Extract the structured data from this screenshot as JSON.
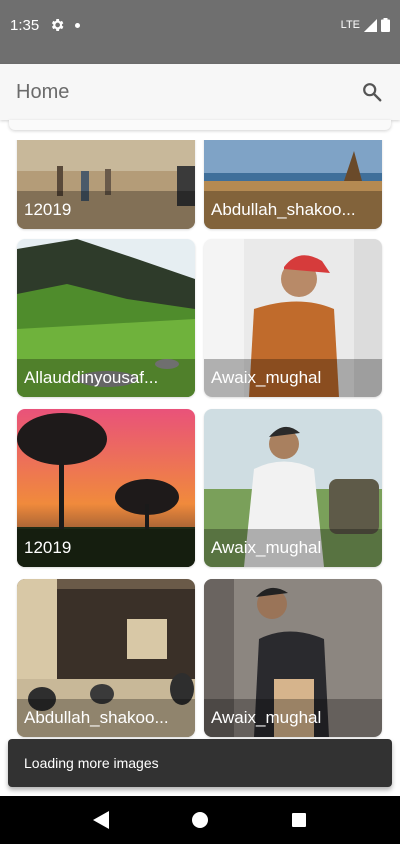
{
  "status_bar": {
    "time": "1:35",
    "network": "LTE"
  },
  "app_bar": {
    "title": "Home"
  },
  "cards": [
    {
      "caption": "12019"
    },
    {
      "caption": "Abdullah_shakoo..."
    },
    {
      "caption": "Allauddinyousaf..."
    },
    {
      "caption": "Awaix_mughal"
    },
    {
      "caption": "12019"
    },
    {
      "caption": "Awaix_mughal"
    },
    {
      "caption": "Abdullah_shakoo..."
    },
    {
      "caption": "Awaix_mughal"
    }
  ],
  "snackbar": {
    "message": "Loading more images"
  },
  "colors": {
    "status_bar": "#6f6f6f",
    "app_bar": "#f7f7f7",
    "snackbar": "#323232",
    "nav_bar": "#000000"
  }
}
